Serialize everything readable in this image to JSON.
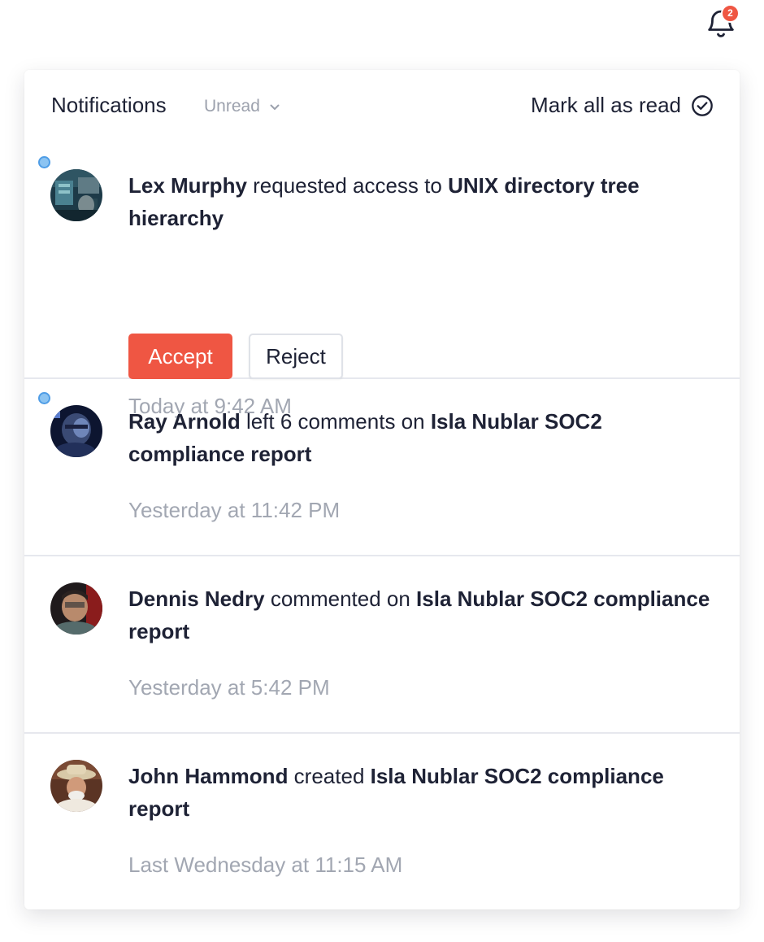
{
  "bell": {
    "icon": "bell-icon",
    "badge_count": "2",
    "badge_color": "#ef5643"
  },
  "panel": {
    "title": "Notifications",
    "filter": {
      "selected": "Unread",
      "icon": "chevron-down-icon"
    },
    "mark_all": {
      "label": "Mark all as read",
      "icon": "check-circle-icon"
    }
  },
  "notifications": [
    {
      "unread": true,
      "actor": "Lex Murphy",
      "action": " requested access to ",
      "target": "UNIX directory tree hierarchy",
      "time": "Today at 9:42 AM",
      "actions": {
        "accept": "Accept",
        "reject": "Reject"
      }
    },
    {
      "unread": true,
      "actor": "Ray Arnold",
      "action": " left 6 comments on ",
      "target": "Isla Nublar SOC2 compliance report",
      "time": "Yesterday at 11:42 PM"
    },
    {
      "unread": false,
      "actor": "Dennis Nedry",
      "action": " commented on ",
      "target": "Isla Nublar SOC2 compliance report",
      "time": "Yesterday at 5:42 PM"
    },
    {
      "unread": false,
      "actor": "John Hammond",
      "action": " created ",
      "target": "Isla Nublar SOC2 compliance report",
      "time": "Last Wednesday at 11:15 AM"
    }
  ],
  "colors": {
    "accent": "#ef5643",
    "unread_dot": "#8cc4f2",
    "text": "#1e2235",
    "muted": "#a2a7b2"
  }
}
